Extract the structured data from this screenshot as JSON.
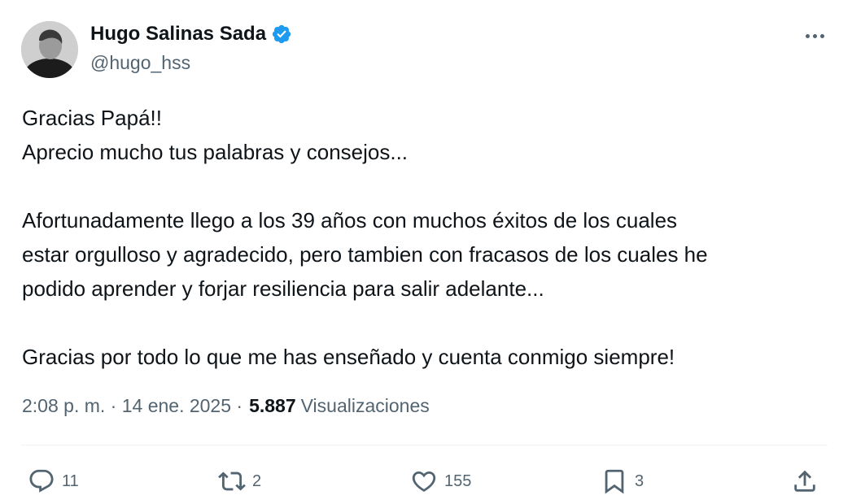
{
  "author": {
    "name": "Hugo Salinas Sada",
    "handle": "@hugo_hss",
    "verified_color": "#1d9bf0"
  },
  "tweet": {
    "paragraphs": [
      [
        "Gracias Papá!!",
        "Aprecio mucho tus palabras y consejos..."
      ],
      [
        "Afortunadamente llego a los 39 años con muchos éxitos de los cuales",
        "estar orgulloso y agradecido, pero tambien con fracasos de los cuales he",
        "podido aprender y forjar resiliencia para salir adelante..."
      ],
      [
        "Gracias por todo lo que me has enseñado y cuenta conmigo siempre!"
      ]
    ],
    "timestamp": "2:08 p. m. · 14 ene. 2025 ·",
    "views_count": "5.887",
    "views_label": "Visualizaciones"
  },
  "actions": {
    "replies": "11",
    "reposts": "2",
    "likes": "155",
    "bookmarks": "3"
  },
  "icons": [
    "avatar",
    "verified-badge-icon",
    "more-icon",
    "reply-icon",
    "repost-icon",
    "like-icon",
    "bookmark-icon",
    "share-icon"
  ]
}
